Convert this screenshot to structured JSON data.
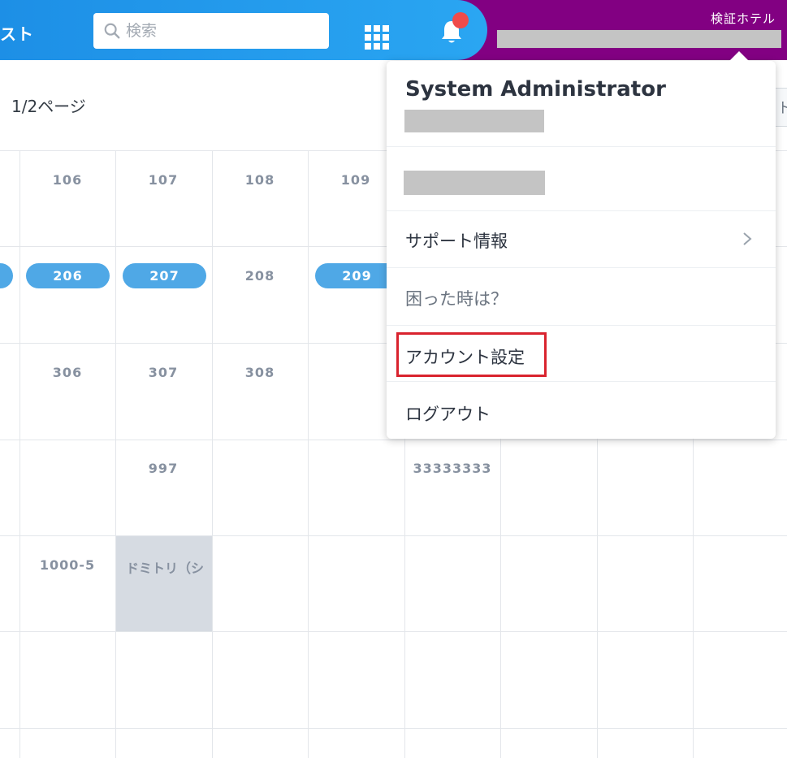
{
  "header": {
    "app_title": "スト",
    "search_placeholder": "検索",
    "hotel_name": "検証ホテル"
  },
  "pagination": {
    "label": "1/2ページ",
    "right_button_label": "ト"
  },
  "grid": {
    "row1": [
      "106",
      "107",
      "108",
      "109"
    ],
    "row2_pills": [
      "206",
      "207",
      "209"
    ],
    "row2_plain": [
      "208"
    ],
    "row3": [
      "306",
      "307",
      "308"
    ],
    "row4": [
      "997",
      "33333333"
    ],
    "row5": [
      "1000-5",
      "ドミトリ（シ"
    ]
  },
  "dropdown": {
    "user_name": "System Administrator",
    "items": [
      {
        "label": "サポート情報"
      },
      {
        "label": "困った時は？"
      },
      {
        "label": "アカウント設定"
      },
      {
        "label": "ログアウト"
      }
    ]
  },
  "colors": {
    "header_blue": "#1d8fe6",
    "header_purple": "#820082",
    "pill_blue": "#4fa8e6",
    "highlight_red": "#d9232e",
    "notification_dot": "#ef4b4b"
  }
}
